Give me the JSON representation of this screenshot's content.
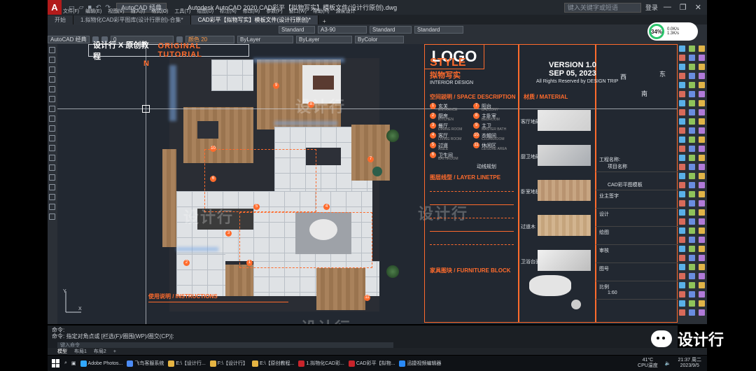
{
  "app": {
    "title": "Autodesk AutoCAD 2020    CAD彩平【拟物写实】模板文件(设计行原创).dwg",
    "logo_letter": "A",
    "workspace": "AutoCAD 经典",
    "search_placeholder": "键入关键字或短语",
    "login": "登录",
    "menu": [
      "文件(F)",
      "编辑(E)",
      "视图(V)",
      "插入(I)",
      "格式(O)",
      "工具(T)",
      "绘图(D)",
      "标注(N)",
      "修改(M)",
      "参数(P)",
      "窗口(W)",
      "帮助(H)",
      "源泉设计"
    ]
  },
  "tabs": [
    {
      "label": "开始"
    },
    {
      "label": "1.拟物化CAD彩平图库(设计行原创)-合集*"
    },
    {
      "label": "CAD彩平【拟物写实】模板文件(设计行原创)*",
      "active": true
    }
  ],
  "props_toolbar": {
    "text_style": "Standard",
    "dim_style": "A3-90",
    "table_style": "Standard",
    "multileader_style": "Standard"
  },
  "layer_toolbar": {
    "workspace": "AutoCAD 经典",
    "layer": "0",
    "color": "颜色 20",
    "linetype": "ByLayer",
    "lineweight": "ByLayer",
    "plotstyle": "ByColor"
  },
  "perf_widget": {
    "percent": "34%",
    "up": "0.0K/s",
    "down": "1.3K/s"
  },
  "canvas": {
    "badge_cn": "设计行 X 原创教程",
    "badge_en": "ORIGINAL TUTORIAL",
    "north": "N",
    "watermark": "设计行",
    "instructions_title": "使用说明 / INSTRUCTIONS",
    "room_numbers": [
      "1",
      "2",
      "3",
      "4",
      "5",
      "6",
      "7",
      "8",
      "9",
      "10",
      "11"
    ]
  },
  "legend": {
    "style_title": "STYLE",
    "style_cn": "拟物写实",
    "style_en": "INTERIOR DESIGN",
    "version": "VERSION 1.0",
    "date": "SEP 05, 2023",
    "rights": "All Rights Reserved by DESIGN TRIP",
    "space_title": "空间説明 / SPACE DESCRIPTION",
    "material_title": "材质 / MATERIAL",
    "layer_title": "图层线型 / LAYER LINETPE",
    "furniture_title": "家具图块 / FURNITURE BLOCK",
    "logo": "LOGO",
    "compass": [
      "西",
      "东",
      "南"
    ],
    "spaces": [
      {
        "n": "1",
        "cn": "玄关",
        "en": "ENTRANCE"
      },
      {
        "n": "2",
        "cn": "厨房",
        "en": "KITCHEN"
      },
      {
        "n": "3",
        "cn": "餐厅",
        "en": "DINING ROOM"
      },
      {
        "n": "4",
        "cn": "客厅",
        "en": "LIVING ROOM"
      },
      {
        "n": "5",
        "cn": "过道",
        "en": "AISLE"
      },
      {
        "n": "6",
        "cn": "卫生间",
        "en": "BATHROOM"
      },
      {
        "n": "7",
        "cn": "阳台",
        "en": "BALCONY"
      },
      {
        "n": "8",
        "cn": "主卧室",
        "en": "BEDROOM"
      },
      {
        "n": "9",
        "cn": "主卫",
        "en": "MASTER BATH"
      },
      {
        "n": "10",
        "cn": "衣帽间",
        "en": "CLOAKROOM"
      },
      {
        "n": "11",
        "cn": "休闲区",
        "en": "LEISURE AREA"
      }
    ],
    "route_label": "动线规划",
    "materials": [
      "客厅地砖",
      "厨卫地砖",
      "卧室地板",
      "过道木",
      "卫浴台面"
    ],
    "info": [
      {
        "k": "工程名称:",
        "v": "项目名称"
      },
      {
        "k": "",
        "v": "CAD彩平图模板"
      },
      {
        "k": "业主签字",
        "v": ""
      },
      {
        "k": "设计",
        "v": ""
      },
      {
        "k": "绘图",
        "v": ""
      },
      {
        "k": "审核",
        "v": ""
      },
      {
        "k": "图号",
        "v": ""
      },
      {
        "k": "比例",
        "v": "1:60"
      }
    ]
  },
  "layout_tabs": [
    "模型",
    "布局1",
    "布局2",
    "+"
  ],
  "command": {
    "line1": "命令:",
    "line2": "命令: 指定对角点或 [栏选(F)/圈围(WP)/圈交(CP)]:",
    "input_placeholder": "键入命令"
  },
  "wechat": {
    "label": "设计行"
  },
  "taskbar": {
    "apps": [
      "Adobe Photos...",
      "飞鸟客服系统",
      "E:\\【设计行...",
      "F:\\【设计行】",
      "E:\\【原创教程...",
      "1.拟物化CAD彩...",
      "CAD彩平【拟物...",
      "迅捷视频编辑器"
    ],
    "temp": "41°C",
    "temp_label": "CPU温度",
    "time": "21:37 周二",
    "date": "2023/9/5"
  }
}
